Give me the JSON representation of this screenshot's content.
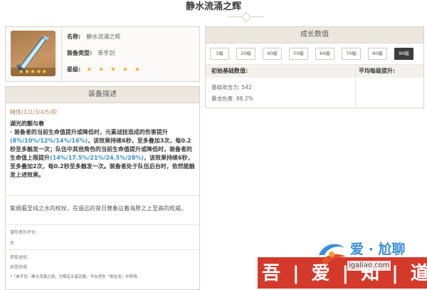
{
  "page": {
    "title": "静水流涌之辉"
  },
  "info": {
    "name_label": "名称:",
    "name_value": "静水流涌之辉",
    "type_label": "装备类型:",
    "type_value": "单手剑",
    "rarity_label": "星级:",
    "rarity_stars": "★ ★ ★ ★ ★",
    "image_stars": "★★★★★",
    "rarity_count": 5
  },
  "description": {
    "heading": "装备描述",
    "refinement": "精炼(1/2/3/4/5)阶",
    "passive_name": "湖光的颤与春",
    "passive_p1": "· 装备者的当前生命值提升或降低时，元素战技造成的伤害提升",
    "passive_hl1": "(8%/10%/12%/14%/16%)",
    "passive_p2": "，该效果持续6秒，至多叠加3次，每0.2秒至多触发一次；队伍中其他角色的当前生命值提升或降低时，装备者的生命值上限提升",
    "passive_hl2": "(14%/17.5%/21%/24.5%/28%)",
    "passive_p3": "，该效果持续6秒，至多叠加2次，每0.2秒至多触发一次。装备者处于队伍后台时，依然能触发上述效果。",
    "lore": "紫绸看至纯之水的权杖，在遥远的昔日曾象征着海原之上至高的权威。",
    "unlock_label": "冒险者的评价:",
    "unlock_value": "无",
    "source_label": "获取途径:",
    "source_value": "祈愿获得",
    "footnote": "*「单手剑 · 静水流涌之辉」为限定五星武器，不在语言「常驻池」中获得。"
  },
  "growth": {
    "heading": "成长数值",
    "levels": [
      "1级",
      "20级",
      "40级",
      "50级",
      "60级",
      "70级",
      "80级",
      "90级"
    ],
    "active_level": "90级",
    "base_header": "初始基础数值:",
    "avg_header": "平均每级提升:",
    "atk": "基础攻击力: 542",
    "crit_dmg": "暴击伤害: 88.2%"
  },
  "watermark": {
    "band_text": "吾 | 爱 | 知 | 道",
    "name": "爱 · 尬聊",
    "url": "igaliao.com",
    "band_color": "#d43a2c",
    "name_color": "#3c8fd8"
  },
  "colors": {
    "highlight_blue": "#3a8fc8",
    "refine_gold": "#b4875a",
    "star_gold": "#e6b229",
    "active_level_bg": "#3d3d3d"
  }
}
